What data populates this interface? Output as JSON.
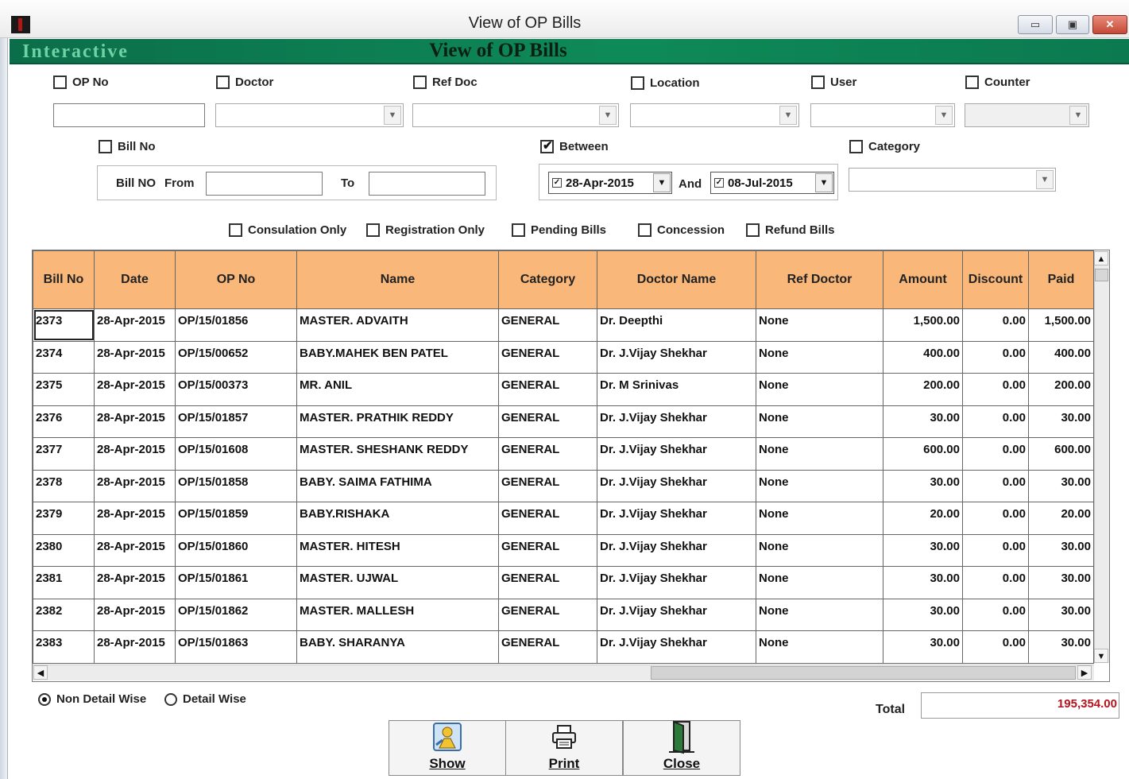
{
  "window": {
    "title": "View of OP Bills",
    "controls": {
      "minimize": "▭",
      "maximize": "▣",
      "close": "✕"
    }
  },
  "banner": {
    "left_text": "Interactive",
    "title": "View of  OP Bills"
  },
  "filters": {
    "op_no": {
      "label": "OP No",
      "checked": false,
      "value": ""
    },
    "doctor": {
      "label": "Doctor",
      "checked": false,
      "value": ""
    },
    "ref_doc": {
      "label": "Ref Doc",
      "checked": false,
      "value": ""
    },
    "location": {
      "label": "Location",
      "checked": false,
      "value": ""
    },
    "user": {
      "label": "User",
      "checked": false,
      "value": ""
    },
    "counter": {
      "label": "Counter",
      "checked": false,
      "value": ""
    },
    "bill_no": {
      "label": "Bill No",
      "checked": false
    },
    "between": {
      "label": "Between",
      "checked": true
    },
    "category": {
      "label": "Category",
      "checked": false,
      "value": ""
    },
    "bill_range": {
      "label": "Bill NO",
      "from_label": "From",
      "to_label": "To",
      "from_value": "",
      "to_value": ""
    },
    "date_range": {
      "from": "28-Apr-2015",
      "and_label": "And",
      "to": "08-Jul-2015"
    },
    "options": [
      {
        "label": "Consulation Only",
        "checked": false
      },
      {
        "label": "Registration Only",
        "checked": false
      },
      {
        "label": "Pending Bills",
        "checked": false
      },
      {
        "label": "Concession",
        "checked": false
      },
      {
        "label": "Refund Bills",
        "checked": false
      }
    ]
  },
  "table": {
    "columns": [
      "Bill No",
      "Date",
      "OP No",
      "Name",
      "Category",
      "Doctor Name",
      "Ref Doctor",
      "Amount",
      "Discount",
      "Paid"
    ],
    "rows": [
      [
        "2373",
        "28-Apr-2015",
        "OP/15/01856",
        "MASTER. ADVAITH",
        "GENERAL",
        "Dr. Deepthi",
        "None",
        "1,500.00",
        "0.00",
        "1,500.00"
      ],
      [
        "2374",
        "28-Apr-2015",
        "OP/15/00652",
        "BABY.MAHEK BEN PATEL",
        "GENERAL",
        "Dr. J.Vijay Shekhar",
        "None",
        "400.00",
        "0.00",
        "400.00"
      ],
      [
        "2375",
        "28-Apr-2015",
        "OP/15/00373",
        "MR. ANIL",
        "GENERAL",
        "Dr. M Srinivas",
        "None",
        "200.00",
        "0.00",
        "200.00"
      ],
      [
        "2376",
        "28-Apr-2015",
        "OP/15/01857",
        "MASTER. PRATHIK REDDY",
        "GENERAL",
        "Dr. J.Vijay Shekhar",
        "None",
        "30.00",
        "0.00",
        "30.00"
      ],
      [
        "2377",
        "28-Apr-2015",
        "OP/15/01608",
        "MASTER. SHESHANK REDDY",
        "GENERAL",
        "Dr. J.Vijay Shekhar",
        "None",
        "600.00",
        "0.00",
        "600.00"
      ],
      [
        "2378",
        "28-Apr-2015",
        "OP/15/01858",
        "BABY. SAIMA FATHIMA",
        "GENERAL",
        "Dr. J.Vijay Shekhar",
        "None",
        "30.00",
        "0.00",
        "30.00"
      ],
      [
        "2379",
        "28-Apr-2015",
        "OP/15/01859",
        "BABY.RISHAKA",
        "GENERAL",
        "Dr. J.Vijay Shekhar",
        "None",
        "20.00",
        "0.00",
        "20.00"
      ],
      [
        "2380",
        "28-Apr-2015",
        "OP/15/01860",
        "MASTER. HITESH",
        "GENERAL",
        "Dr. J.Vijay Shekhar",
        "None",
        "30.00",
        "0.00",
        "30.00"
      ],
      [
        "2381",
        "28-Apr-2015",
        "OP/15/01861",
        "MASTER. UJWAL",
        "GENERAL",
        "Dr. J.Vijay Shekhar",
        "None",
        "30.00",
        "0.00",
        "30.00"
      ],
      [
        "2382",
        "28-Apr-2015",
        "OP/15/01862",
        "MASTER. MALLESH",
        "GENERAL",
        "Dr. J.Vijay Shekhar",
        "None",
        "30.00",
        "0.00",
        "30.00"
      ],
      [
        "2383",
        "28-Apr-2015",
        "OP/15/01863",
        "BABY. SHARANYA",
        "GENERAL",
        "Dr. J.Vijay Shekhar",
        "None",
        "30.00",
        "0.00",
        "30.00"
      ]
    ],
    "header_color": "#f9b87a"
  },
  "view_mode": {
    "non_detail": {
      "label": "Non Detail Wise",
      "selected": true
    },
    "detail": {
      "label": "Detail Wise",
      "selected": false
    }
  },
  "total": {
    "label": "Total",
    "value": "195,354.00"
  },
  "actions": [
    {
      "label": "Show",
      "icon": "show-icon"
    },
    {
      "label": "Print",
      "icon": "print-icon"
    },
    {
      "label": "Close",
      "icon": "door-close-icon"
    }
  ],
  "colors": {
    "banner": "#0e8a58",
    "total_text": "#b4141e",
    "grid_header": "#f9b87a"
  }
}
